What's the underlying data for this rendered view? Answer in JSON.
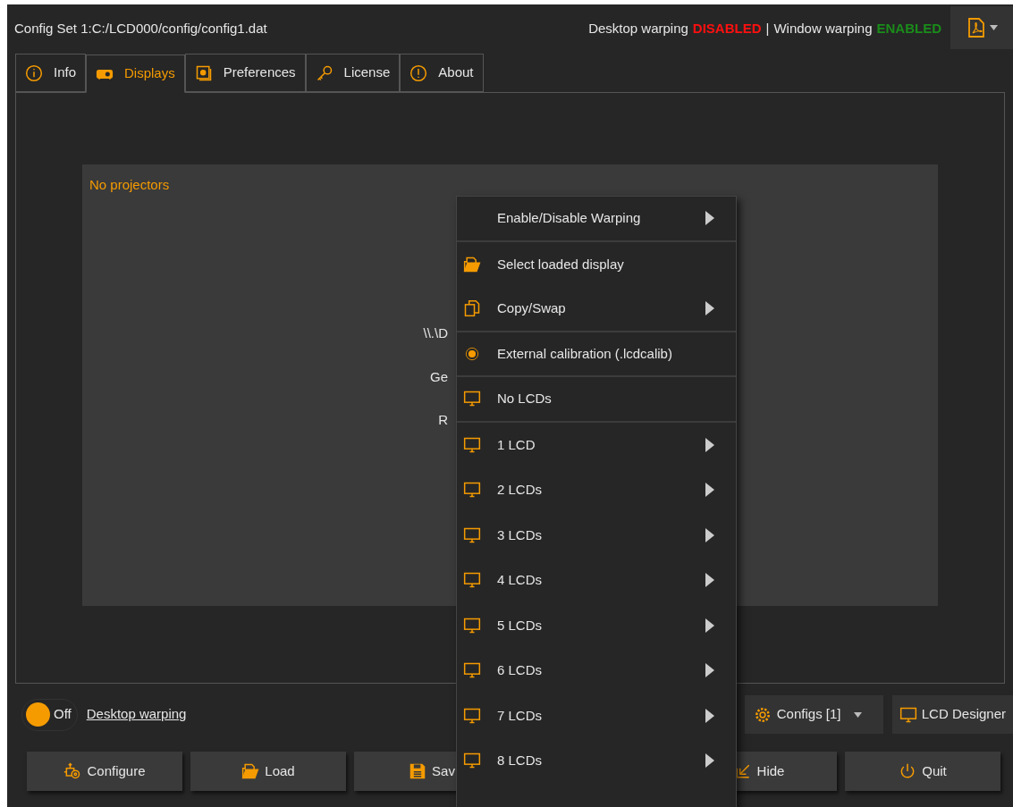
{
  "header": {
    "config_path": "Config Set 1:C:/LCD000/config/config1.dat",
    "status": [
      {
        "text": "Desktop warping",
        "kind": "label"
      },
      {
        "text": "DISABLED",
        "kind": "off"
      },
      {
        "text": "|",
        "kind": "label"
      },
      {
        "text": "Window warping",
        "kind": "label"
      },
      {
        "text": "ENABLED",
        "kind": "on"
      }
    ]
  },
  "tabs": [
    {
      "label": "Info",
      "kind": "info",
      "selected": false
    },
    {
      "label": "Displays",
      "kind": "projector",
      "selected": true
    },
    {
      "label": "Preferences",
      "kind": "preferences",
      "selected": false
    },
    {
      "label": "License",
      "kind": "key",
      "selected": false
    },
    {
      "label": "About",
      "kind": "about",
      "selected": false
    }
  ],
  "panel": {
    "message": "No projectors",
    "covered_lines": [
      "\\\\.\\D",
      "Ge",
      "R"
    ]
  },
  "warping_toggle": {
    "on": false,
    "label": "Off"
  },
  "desktop_link": "Desktop warping",
  "configs_button": "Configs [1]",
  "designer_button": "LCD Designer",
  "buttons": [
    {
      "label": "Configure",
      "kind": "configure"
    },
    {
      "label": "Load",
      "kind": "load"
    },
    {
      "label": "Sav",
      "kind": "save"
    },
    {
      "kind": "hidden"
    },
    {
      "label": "Hide",
      "kind": "hide"
    },
    {
      "label": "Quit",
      "kind": "quit"
    }
  ],
  "context_menu": [
    {
      "label": "Enable/Disable Warping",
      "kind": "none",
      "submenu": true,
      "separator_after": true
    },
    {
      "label": "Select loaded display",
      "kind": "folder",
      "submenu": false,
      "separator_after": false
    },
    {
      "label": "Copy/Swap",
      "kind": "copy",
      "submenu": true,
      "separator_after": true
    },
    {
      "label": "External calibration (.lcdcalib)",
      "kind": "target",
      "submenu": false,
      "separator_after": true
    },
    {
      "label": "No LCDs",
      "kind": "monitor",
      "submenu": false,
      "separator_after": true
    },
    {
      "label": "1 LCD",
      "kind": "monitor",
      "submenu": true,
      "separator_after": false
    },
    {
      "label": "2 LCDs",
      "kind": "monitor",
      "submenu": true,
      "separator_after": false
    },
    {
      "label": "3 LCDs",
      "kind": "monitor",
      "submenu": true,
      "separator_after": false
    },
    {
      "label": "4 LCDs",
      "kind": "monitor",
      "submenu": true,
      "separator_after": false
    },
    {
      "label": "5 LCDs",
      "kind": "monitor",
      "submenu": true,
      "separator_after": false
    },
    {
      "label": "6 LCDs",
      "kind": "monitor",
      "submenu": true,
      "separator_after": false
    },
    {
      "label": "7 LCDs",
      "kind": "monitor",
      "submenu": true,
      "separator_after": false
    },
    {
      "label": "8 LCDs",
      "kind": "monitor",
      "submenu": true,
      "separator_after": false
    }
  ]
}
